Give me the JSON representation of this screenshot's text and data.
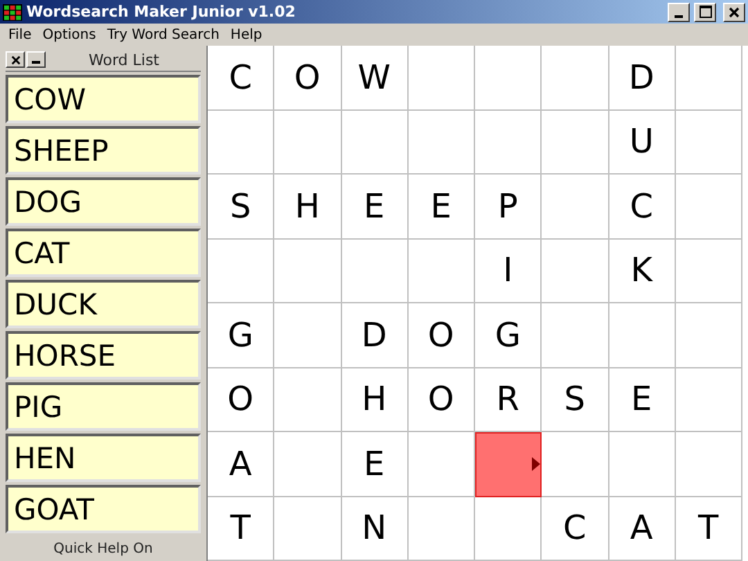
{
  "window": {
    "title": "Wordsearch Maker Junior v1.02"
  },
  "menu": [
    "File",
    "Options",
    "Try Word Search",
    "Help"
  ],
  "word_list": {
    "title": "Word List",
    "words": [
      "COW",
      "SHEEP",
      "DOG",
      "CAT",
      "DUCK",
      "HORSE",
      "PIG",
      "HEN",
      "GOAT"
    ],
    "footer": "Quick Help On"
  },
  "grid": {
    "rows": [
      [
        {
          "letter": "C"
        },
        {
          "letter": "O"
        },
        {
          "letter": "W"
        },
        {},
        {},
        {},
        {
          "letter": "D"
        },
        {}
      ],
      [
        {},
        {},
        {},
        {},
        {},
        {},
        {
          "letter": "U"
        },
        {}
      ],
      [
        {
          "letter": "S"
        },
        {
          "letter": "H"
        },
        {
          "letter": "E"
        },
        {
          "letter": "E"
        },
        {
          "letter": "P"
        },
        {},
        {
          "letter": "C"
        },
        {}
      ],
      [
        {},
        {},
        {},
        {},
        {
          "letter": "I"
        },
        {},
        {
          "letter": "K"
        },
        {}
      ],
      [
        {
          "letter": "G"
        },
        {},
        {
          "letter": "D"
        },
        {
          "letter": "O"
        },
        {
          "letter": "G"
        },
        {},
        {},
        {}
      ],
      [
        {
          "letter": "O"
        },
        {},
        {
          "letter": "H"
        },
        {
          "letter": "O"
        },
        {
          "letter": "R"
        },
        {
          "letter": "S"
        },
        {
          "letter": "E"
        },
        {}
      ],
      [
        {
          "letter": "A"
        },
        {},
        {
          "letter": "E"
        },
        {},
        {
          "selected": true
        },
        {},
        {},
        {}
      ],
      [
        {
          "letter": "T"
        },
        {},
        {
          "letter": "N"
        },
        {},
        {},
        {
          "letter": "C"
        },
        {
          "letter": "A"
        },
        {
          "letter": "T"
        }
      ]
    ]
  }
}
